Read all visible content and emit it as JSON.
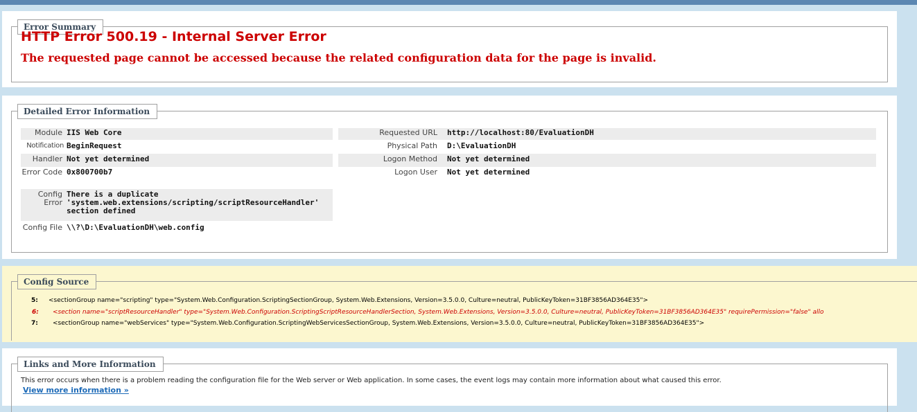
{
  "summary": {
    "legend": "Error Summary",
    "title": "HTTP Error 500.19 - Internal Server Error",
    "subtitle": "The requested page cannot be accessed because the related configuration data for the page is invalid."
  },
  "detail": {
    "legend": "Detailed Error Information",
    "left": [
      {
        "key": "Module",
        "value": "IIS Web Core"
      },
      {
        "key": "Notification",
        "value": "BeginRequest"
      },
      {
        "key": "Handler",
        "value": "Not yet determined"
      },
      {
        "key": "Error Code",
        "value": "0x800700b7"
      },
      {
        "key": "Config Error",
        "value": "There is a duplicate 'system.web.extensions/scripting/scriptResourceHandler' section defined"
      },
      {
        "key": "Config File",
        "value": "\\\\?\\D:\\EvaluationDH\\web.config"
      }
    ],
    "right": [
      {
        "key": "Requested URL",
        "value": "http://localhost:80/EvaluationDH"
      },
      {
        "key": "Physical Path",
        "value": "D:\\EvaluationDH"
      },
      {
        "key": "Logon Method",
        "value": "Not yet determined"
      },
      {
        "key": "Logon User",
        "value": "Not yet determined"
      }
    ]
  },
  "config": {
    "legend": "Config Source",
    "lines": [
      {
        "num": "5:",
        "text": "<sectionGroup name=\"scripting\" type=\"System.Web.Configuration.ScriptingSectionGroup, System.Web.Extensions, Version=3.5.0.0, Culture=neutral, PublicKeyToken=31BF3856AD364E35\">"
      },
      {
        "num": "6:",
        "text": "<section name=\"scriptResourceHandler\" type=\"System.Web.Configuration.ScriptingScriptResourceHandlerSection, System.Web.Extensions, Version=3.5.0.0, Culture=neutral, PublicKeyToken=31BF3856AD364E35\" requirePermission=\"false\" allo"
      },
      {
        "num": "7:",
        "text": "<sectionGroup name=\"webServices\" type=\"System.Web.Configuration.ScriptingWebServicesSectionGroup, System.Web.Extensions, Version=3.5.0.0, Culture=neutral, PublicKeyToken=31BF3856AD364E35\">"
      }
    ]
  },
  "links": {
    "legend": "Links and More Information",
    "text": "This error occurs when there is a problem reading the configuration file for the Web server or Web application. In some cases, the event logs may contain more information about what caused this error.",
    "link": "View more information »"
  },
  "colors": {
    "header_bar": "#5C87B2",
    "background": "#CBE1EF",
    "error_red": "#CC0000",
    "config_bg": "#FCF7CF",
    "link_blue": "#1E6BB8"
  }
}
